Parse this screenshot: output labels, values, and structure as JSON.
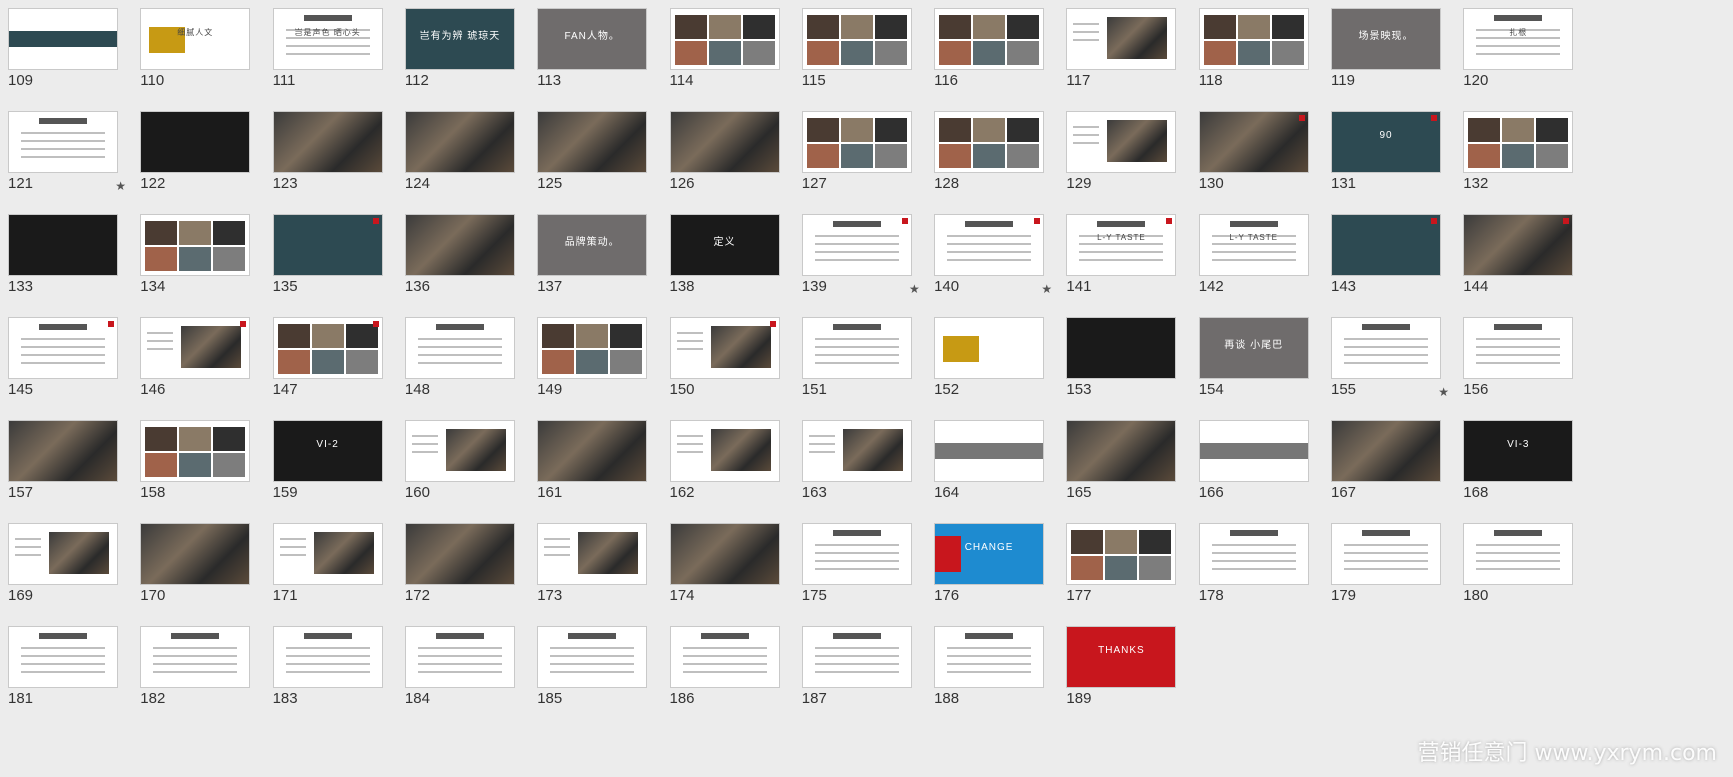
{
  "app": {
    "view": "Slide Sorter"
  },
  "slides": [
    {
      "n": "109",
      "t": "teal-band"
    },
    {
      "n": "110",
      "t": "gold",
      "text": "细腻人文"
    },
    {
      "n": "111",
      "t": "white-text",
      "text": "岂是声色 晒心头"
    },
    {
      "n": "112",
      "t": "teal",
      "text": "岂有为辨 琥琼天"
    },
    {
      "n": "113",
      "t": "gray",
      "text": "FAN人物。"
    },
    {
      "n": "114",
      "t": "photo-grid"
    },
    {
      "n": "115",
      "t": "photo-grid"
    },
    {
      "n": "116",
      "t": "photo-grid"
    },
    {
      "n": "117",
      "t": "white-photo"
    },
    {
      "n": "118",
      "t": "photo-grid"
    },
    {
      "n": "119",
      "t": "gray",
      "text": "场景映现。"
    },
    {
      "n": "120",
      "t": "white-text",
      "text": "扎根"
    },
    {
      "n": "121",
      "t": "diagram",
      "starred": true
    },
    {
      "n": "122",
      "t": "dark"
    },
    {
      "n": "123",
      "t": "photo"
    },
    {
      "n": "124",
      "t": "photo"
    },
    {
      "n": "125",
      "t": "photo"
    },
    {
      "n": "126",
      "t": "photo"
    },
    {
      "n": "127",
      "t": "photo-grid"
    },
    {
      "n": "128",
      "t": "photo-grid"
    },
    {
      "n": "129",
      "t": "white-photo"
    },
    {
      "n": "130",
      "t": "photo"
    },
    {
      "n": "131",
      "t": "teal",
      "text": "90"
    },
    {
      "n": "132",
      "t": "photo-grid"
    },
    {
      "n": "133",
      "t": "dark"
    },
    {
      "n": "134",
      "t": "photo-grid"
    },
    {
      "n": "135",
      "t": "teal"
    },
    {
      "n": "136",
      "t": "photo"
    },
    {
      "n": "137",
      "t": "gray",
      "text": "品牌策动。"
    },
    {
      "n": "138",
      "t": "dark",
      "text": "定义"
    },
    {
      "n": "139",
      "t": "diagram",
      "starred": true
    },
    {
      "n": "140",
      "t": "diagram",
      "starred": true
    },
    {
      "n": "141",
      "t": "white-text",
      "text": "L-Y TASTE"
    },
    {
      "n": "142",
      "t": "white-text",
      "text": "L-Y TASTE"
    },
    {
      "n": "143",
      "t": "teal"
    },
    {
      "n": "144",
      "t": "photo"
    },
    {
      "n": "145",
      "t": "white-text"
    },
    {
      "n": "146",
      "t": "white-photo"
    },
    {
      "n": "147",
      "t": "photo-grid"
    },
    {
      "n": "148",
      "t": "white-text"
    },
    {
      "n": "149",
      "t": "photo-grid"
    },
    {
      "n": "150",
      "t": "white-photo"
    },
    {
      "n": "151",
      "t": "diagram"
    },
    {
      "n": "152",
      "t": "gold"
    },
    {
      "n": "153",
      "t": "dark"
    },
    {
      "n": "154",
      "t": "gray",
      "text": "再谈 小尾巴"
    },
    {
      "n": "155",
      "t": "diagram",
      "starred": true
    },
    {
      "n": "156",
      "t": "diagram"
    },
    {
      "n": "157",
      "t": "photo"
    },
    {
      "n": "158",
      "t": "photo-grid"
    },
    {
      "n": "159",
      "t": "dark",
      "text": "VI-2"
    },
    {
      "n": "160",
      "t": "white-photo"
    },
    {
      "n": "161",
      "t": "photo"
    },
    {
      "n": "162",
      "t": "white-photo"
    },
    {
      "n": "163",
      "t": "white-photo"
    },
    {
      "n": "164",
      "t": "band"
    },
    {
      "n": "165",
      "t": "photo"
    },
    {
      "n": "166",
      "t": "band"
    },
    {
      "n": "167",
      "t": "photo"
    },
    {
      "n": "168",
      "t": "dark",
      "text": "VI-3"
    },
    {
      "n": "169",
      "t": "white-photo"
    },
    {
      "n": "170",
      "t": "photo"
    },
    {
      "n": "171",
      "t": "white-photo"
    },
    {
      "n": "172",
      "t": "photo"
    },
    {
      "n": "173",
      "t": "white-photo"
    },
    {
      "n": "174",
      "t": "photo"
    },
    {
      "n": "175",
      "t": "white-text"
    },
    {
      "n": "176",
      "t": "change",
      "text": "CHANGE"
    },
    {
      "n": "177",
      "t": "photo-grid"
    },
    {
      "n": "178",
      "t": "white-text"
    },
    {
      "n": "179",
      "t": "white-text"
    },
    {
      "n": "180",
      "t": "white-text"
    },
    {
      "n": "181",
      "t": "white-text"
    },
    {
      "n": "182",
      "t": "white-text"
    },
    {
      "n": "183",
      "t": "white-text"
    },
    {
      "n": "184",
      "t": "white-text"
    },
    {
      "n": "185",
      "t": "white-text"
    },
    {
      "n": "186",
      "t": "white-text"
    },
    {
      "n": "187",
      "t": "white-text"
    },
    {
      "n": "188",
      "t": "white-text"
    },
    {
      "n": "189",
      "t": "red",
      "text": "THANKS"
    }
  ],
  "watermark": "营销任意门 www.yxrym.com",
  "colors": {
    "background": "#ececec",
    "accent_red": "#c8161d",
    "gold": "#c79a14",
    "teal": "#2d4a52"
  }
}
